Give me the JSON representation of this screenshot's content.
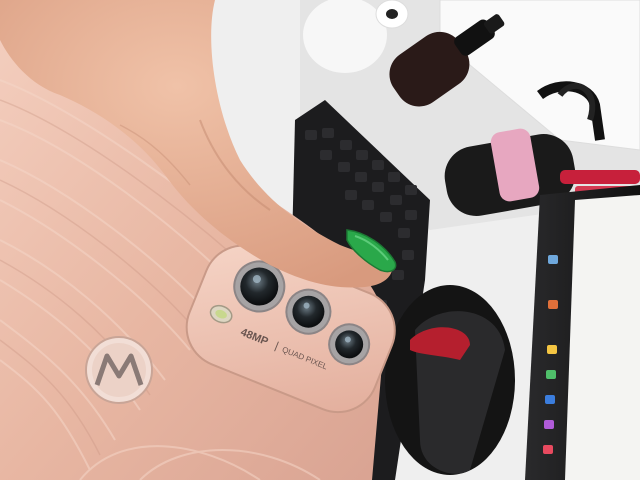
{
  "photo": {
    "camera_module": {
      "megapixel_label": "48MP",
      "separator": "|",
      "feature_label": "QUAD PIXEL"
    },
    "phone_color": "#e9b9a6",
    "nail_polish_color": "#2aa84a",
    "desk_color": "#f2f2f2",
    "keyboard_color": "#1c1c1e"
  }
}
